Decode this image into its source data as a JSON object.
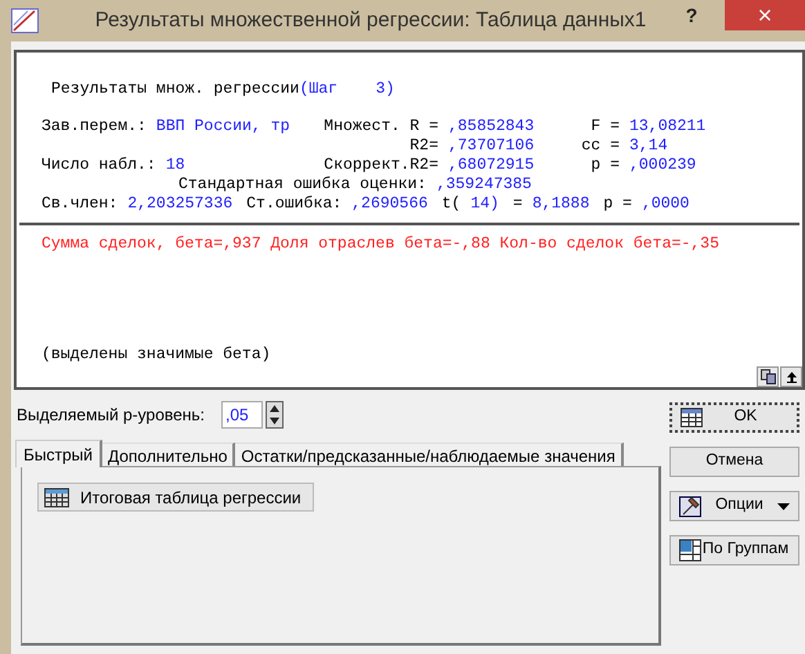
{
  "window": {
    "title": "Результаты множественной регрессии: Таблица данных1",
    "help": "?",
    "close": "×"
  },
  "report": {
    "heading": {
      "label": "Результаты множ. регрессии",
      "value": "(Шаг    3)"
    },
    "stats": [
      {
        "kind": "grid",
        "pairs": [
          {
            "kind": "pair",
            "label": "Зав.перем.:",
            "value": "ВВП России, тр"
          },
          {
            "kind": "pair",
            "label": "Множест. R =",
            "value": ",85852843"
          },
          {
            "kind": "pair",
            "label": "F =",
            "value": "13,08211"
          }
        ]
      },
      {
        "kind": "grid",
        "pairs": [
          {
            "kind": "blank"
          },
          {
            "kind": "pair",
            "label": "R2=",
            "value": ",73707106"
          },
          {
            "kind": "pair",
            "label": "cc =",
            "value": "3,14"
          }
        ]
      },
      {
        "kind": "grid",
        "pairs": [
          {
            "kind": "pair",
            "label": "Число набл.:",
            "value": "18"
          },
          {
            "kind": "pair",
            "label": "Скоррект.R2=",
            "value": ",68072915"
          },
          {
            "kind": "pair",
            "label": "p =",
            "value": ",000239"
          }
        ]
      },
      {
        "kind": "indent",
        "pairs": [
          {
            "kind": "pair",
            "label": "Стандартная ошибка оценки:",
            "value": ",359247385"
          }
        ]
      },
      {
        "kind": "flow",
        "pairs": [
          {
            "kind": "pair",
            "label": "Св.член:",
            "value": "2,203257336"
          },
          {
            "kind": "pair",
            "label": "Ст.ошибка:",
            "value": ",2690566"
          },
          {
            "kind": "pair",
            "label": "t(",
            "value": "14)"
          },
          {
            "kind": "pair",
            "label": "=",
            "value": "8,1888"
          },
          {
            "kind": "pair",
            "label": "p =",
            "value": ",0000"
          }
        ]
      }
    ],
    "betas": "Сумма сделок, бета=,937 Доля отраслев бета=-,88 Кол-во сделок бета=-,35",
    "note": "(выделены значимые бета)"
  },
  "p_level": {
    "label": "Выделяемый р-уровень:",
    "value": ",05"
  },
  "tabs": [
    {
      "label": "Быстрый",
      "selected": true
    },
    {
      "label": "Дополнительно",
      "selected": false
    },
    {
      "label": "Остатки/предсказанные/наблюдаемые значения",
      "selected": false
    }
  ],
  "tab_buttons": [
    "Итоговая таблица регрессии"
  ],
  "side_buttons": [
    {
      "kind": "ok",
      "label": "OK"
    },
    {
      "kind": "cancel",
      "label": "Отмена"
    },
    {
      "kind": "options",
      "label": "Опции"
    },
    {
      "kind": "groups",
      "label": "По Группам"
    }
  ]
}
